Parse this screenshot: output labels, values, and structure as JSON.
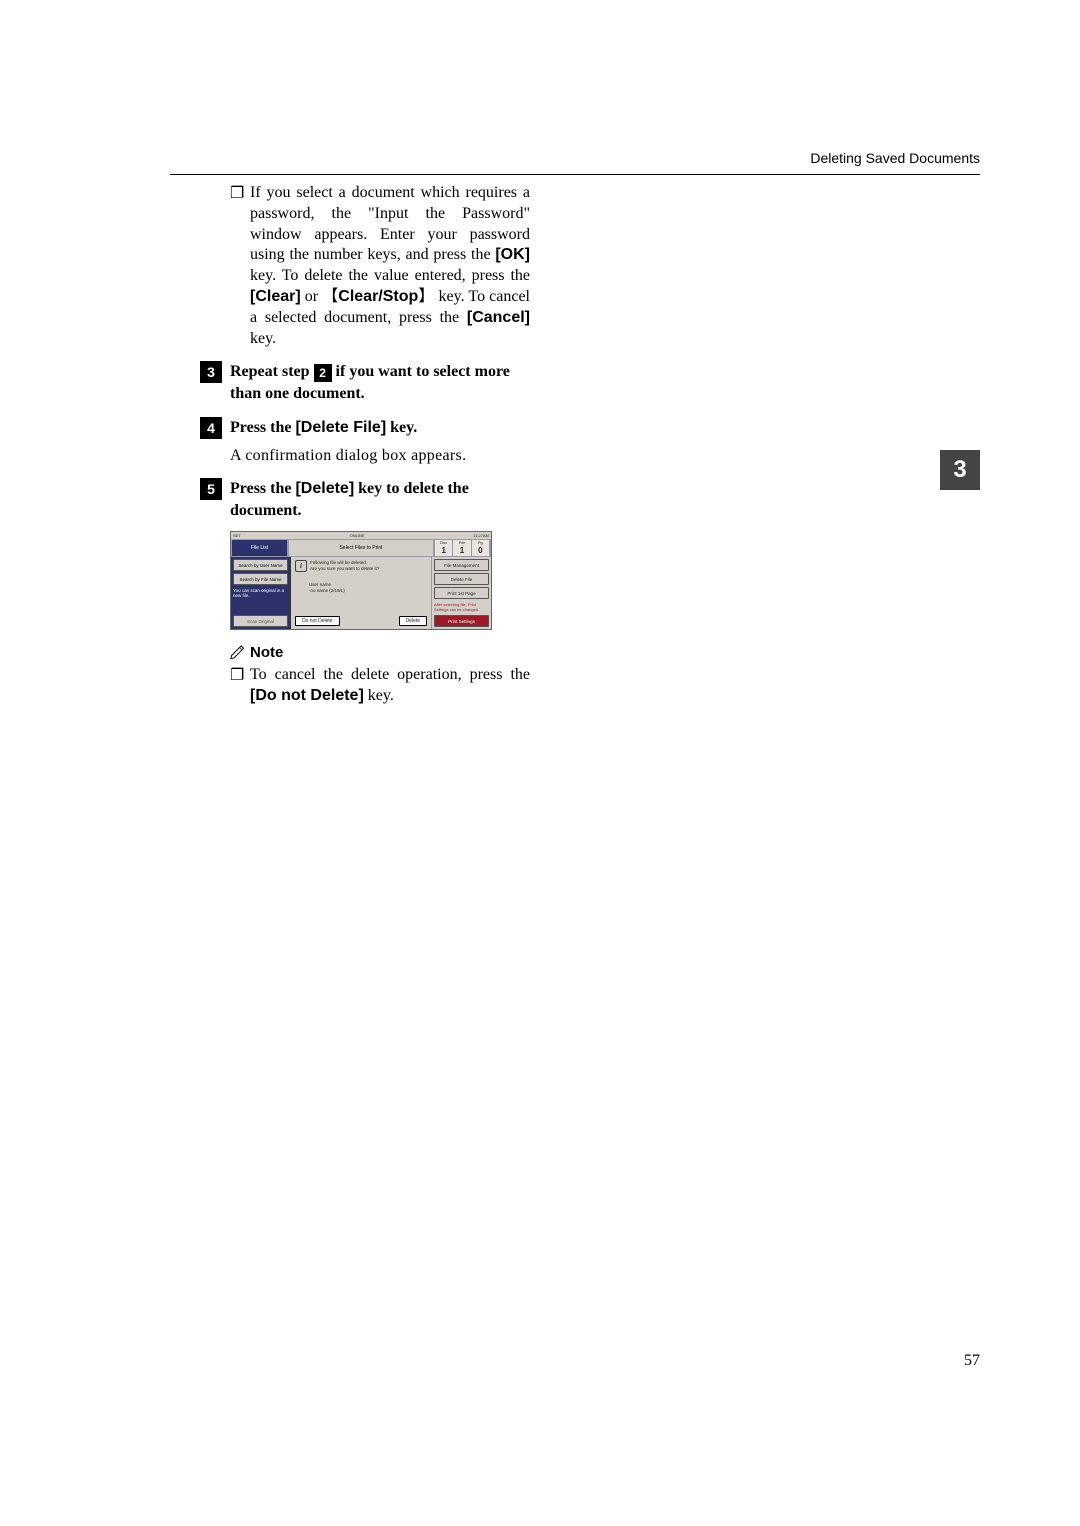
{
  "header": {
    "section": "Deleting Saved Documents"
  },
  "chapter_tab": "3",
  "page_number": "57",
  "body": {
    "bullet1_prefix": "❐",
    "bullet1_t1": "If you select a document which requires a password, the \"Input the Password\" window appears. Enter your password using the number keys, and press the ",
    "bullet1_k1": "[OK]",
    "bullet1_t2": " key. To delete the value entered, press the ",
    "bullet1_k2": "[Clear]",
    "bullet1_t3": " or ",
    "bullet1_k3": "Clear/Stop",
    "bullet1_t4": " key. To cancel a selected document, press the ",
    "bullet1_k4": "[Cancel]",
    "bullet1_t5": " key."
  },
  "steps": {
    "s3_num": "3",
    "s3_t1": "Repeat step ",
    "s3_ref": "2",
    "s3_t2": " if you want to select more than one document.",
    "s4_num": "4",
    "s4_t1": "Press the ",
    "s4_k1": "[Delete File]",
    "s4_t2": " key.",
    "s4_body": "A confirmation dialog box appears.",
    "s5_num": "5",
    "s5_t1": "Press the ",
    "s5_k1": "[Delete]",
    "s5_t2": " key to delete the document."
  },
  "note": {
    "heading": "Note",
    "bullet_sym": "❐",
    "t1": "To cancel the delete operation, press the ",
    "k1": "[Do not Delete]",
    "t2": " key."
  },
  "screenshot": {
    "status_left": "SET",
    "status_center": "ONLINE",
    "status_right": "11:27AM",
    "tab_filelist": "File List",
    "title": "Select Files to Print",
    "counter_labels": {
      "a": "Doc",
      "b": "File",
      "c": "Pg"
    },
    "counter_values": {
      "a": "1",
      "b": "1",
      "c": "0"
    },
    "left": {
      "btn_user": "Search by User Name",
      "btn_file": "Search by File Name",
      "msg": "You can scan original in a new file.",
      "btn_scan": "Scan Original"
    },
    "center": {
      "dlg_line1": "Following file will be deleted.",
      "dlg_line2": "Are you sure you want to delete it?",
      "user_label": "User name",
      "user_value": "-no name (2/19/L)",
      "btn_cancel": "Do not Delete",
      "btn_ok": "Delete"
    },
    "right": {
      "btn_mgmt": "File Management",
      "btn_delete": "Delete File",
      "btn_first": "Print 1st Page",
      "msg": "After selecting file, Print Settings can be changed.",
      "btn_settings": "Print Settings"
    }
  }
}
